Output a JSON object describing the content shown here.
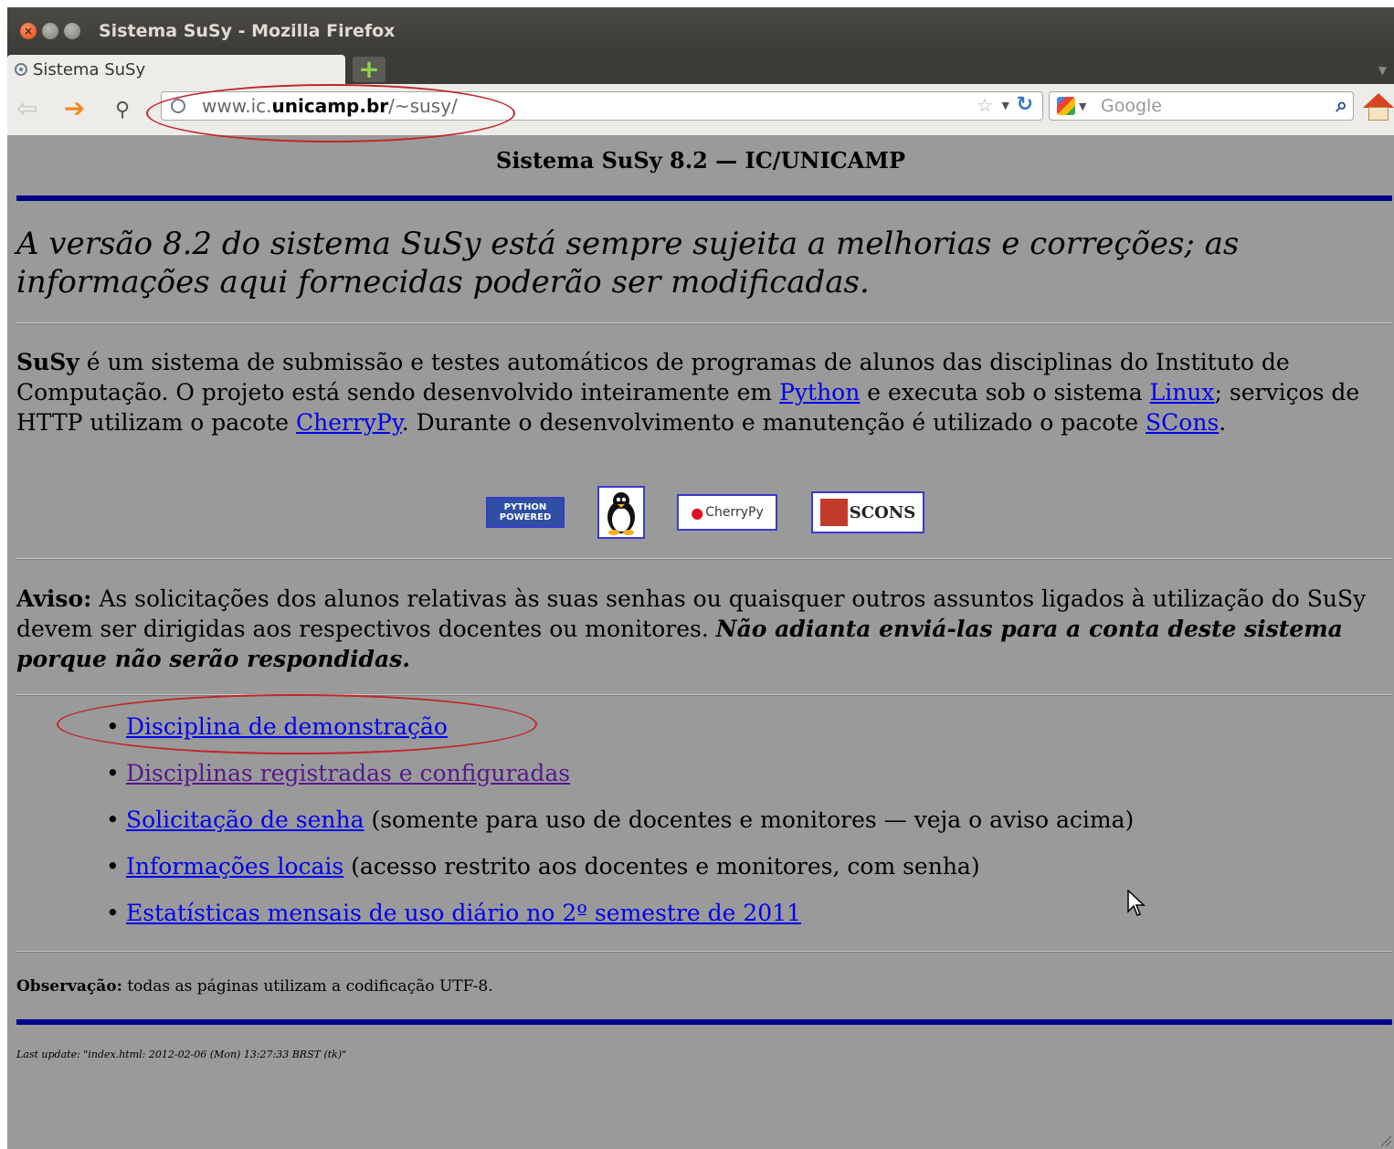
{
  "window": {
    "title": "Sistema SuSy - Mozilla Firefox"
  },
  "tab": {
    "label": "Sistema SuSy"
  },
  "url": {
    "prefix": "www.ic.",
    "domain": "unicamp.br",
    "suffix": "/~susy/"
  },
  "search": {
    "placeholder": "Google"
  },
  "page": {
    "title": "Sistema SuSy 8.2 — IC/UNICAMP",
    "notice": "A versão 8.2 do sistema SuSy está sempre sujeita a melhorias e correções; as informações aqui fornecidas poderão ser modificadas.",
    "intro": {
      "brand": "SuSy",
      "t1": " é um sistema de submissão e testes automáticos de programas de alunos das disciplinas do Instituto de Computação. O projeto está sendo desenvolvido inteiramente em ",
      "python": "Python",
      "t2": " e executa sob o sistema ",
      "linux": "Linux",
      "t3": "; serviços de HTTP utilizam o pacote ",
      "cherrypy": "CherryPy",
      "t4": ". Durante o desenvolvimento e manutenção é utilizado o pacote ",
      "scons": "SCons",
      "t5": "."
    },
    "badges": {
      "python": "PYTHON POWERED",
      "cherrypy": "CherryPy",
      "scons": "SCONS"
    },
    "aviso": {
      "label": "Aviso:",
      "text": " As solicitações dos alunos relativas às suas senhas ou quaisquer outros assuntos ligados à utilização do SuSy devem ser dirigidas aos respectivos docentes ou monitores. ",
      "emphasis": "Não adianta enviá-las para a conta deste sistema porque não serão respondidas."
    },
    "links": [
      {
        "label": "Disciplina de demonstração",
        "note": ""
      },
      {
        "label": "Disciplinas registradas e configuradas",
        "note": ""
      },
      {
        "label": "Solicitação de senha",
        "note": " (somente para uso de docentes e monitores — veja o aviso acima)"
      },
      {
        "label": "Informações locais",
        "note": " (acesso restrito aos docentes e monitores, com senha)"
      },
      {
        "label": "Estatísticas mensais de uso diário no 2º semestre de 2011",
        "note": ""
      }
    ],
    "observacao": {
      "label": "Observação:",
      "text": " todas as páginas utilizam a codificação UTF-8."
    },
    "last_update": "Last update: \"index.html: 2012-02-06 (Mon) 13:27:33 BRST (tk)\""
  },
  "colors": {
    "page_bg": "#9a9a9a",
    "rule_blue": "#00008b",
    "link": "#0000ee",
    "visited": "#551a8b",
    "annotation": "#c0262c"
  }
}
